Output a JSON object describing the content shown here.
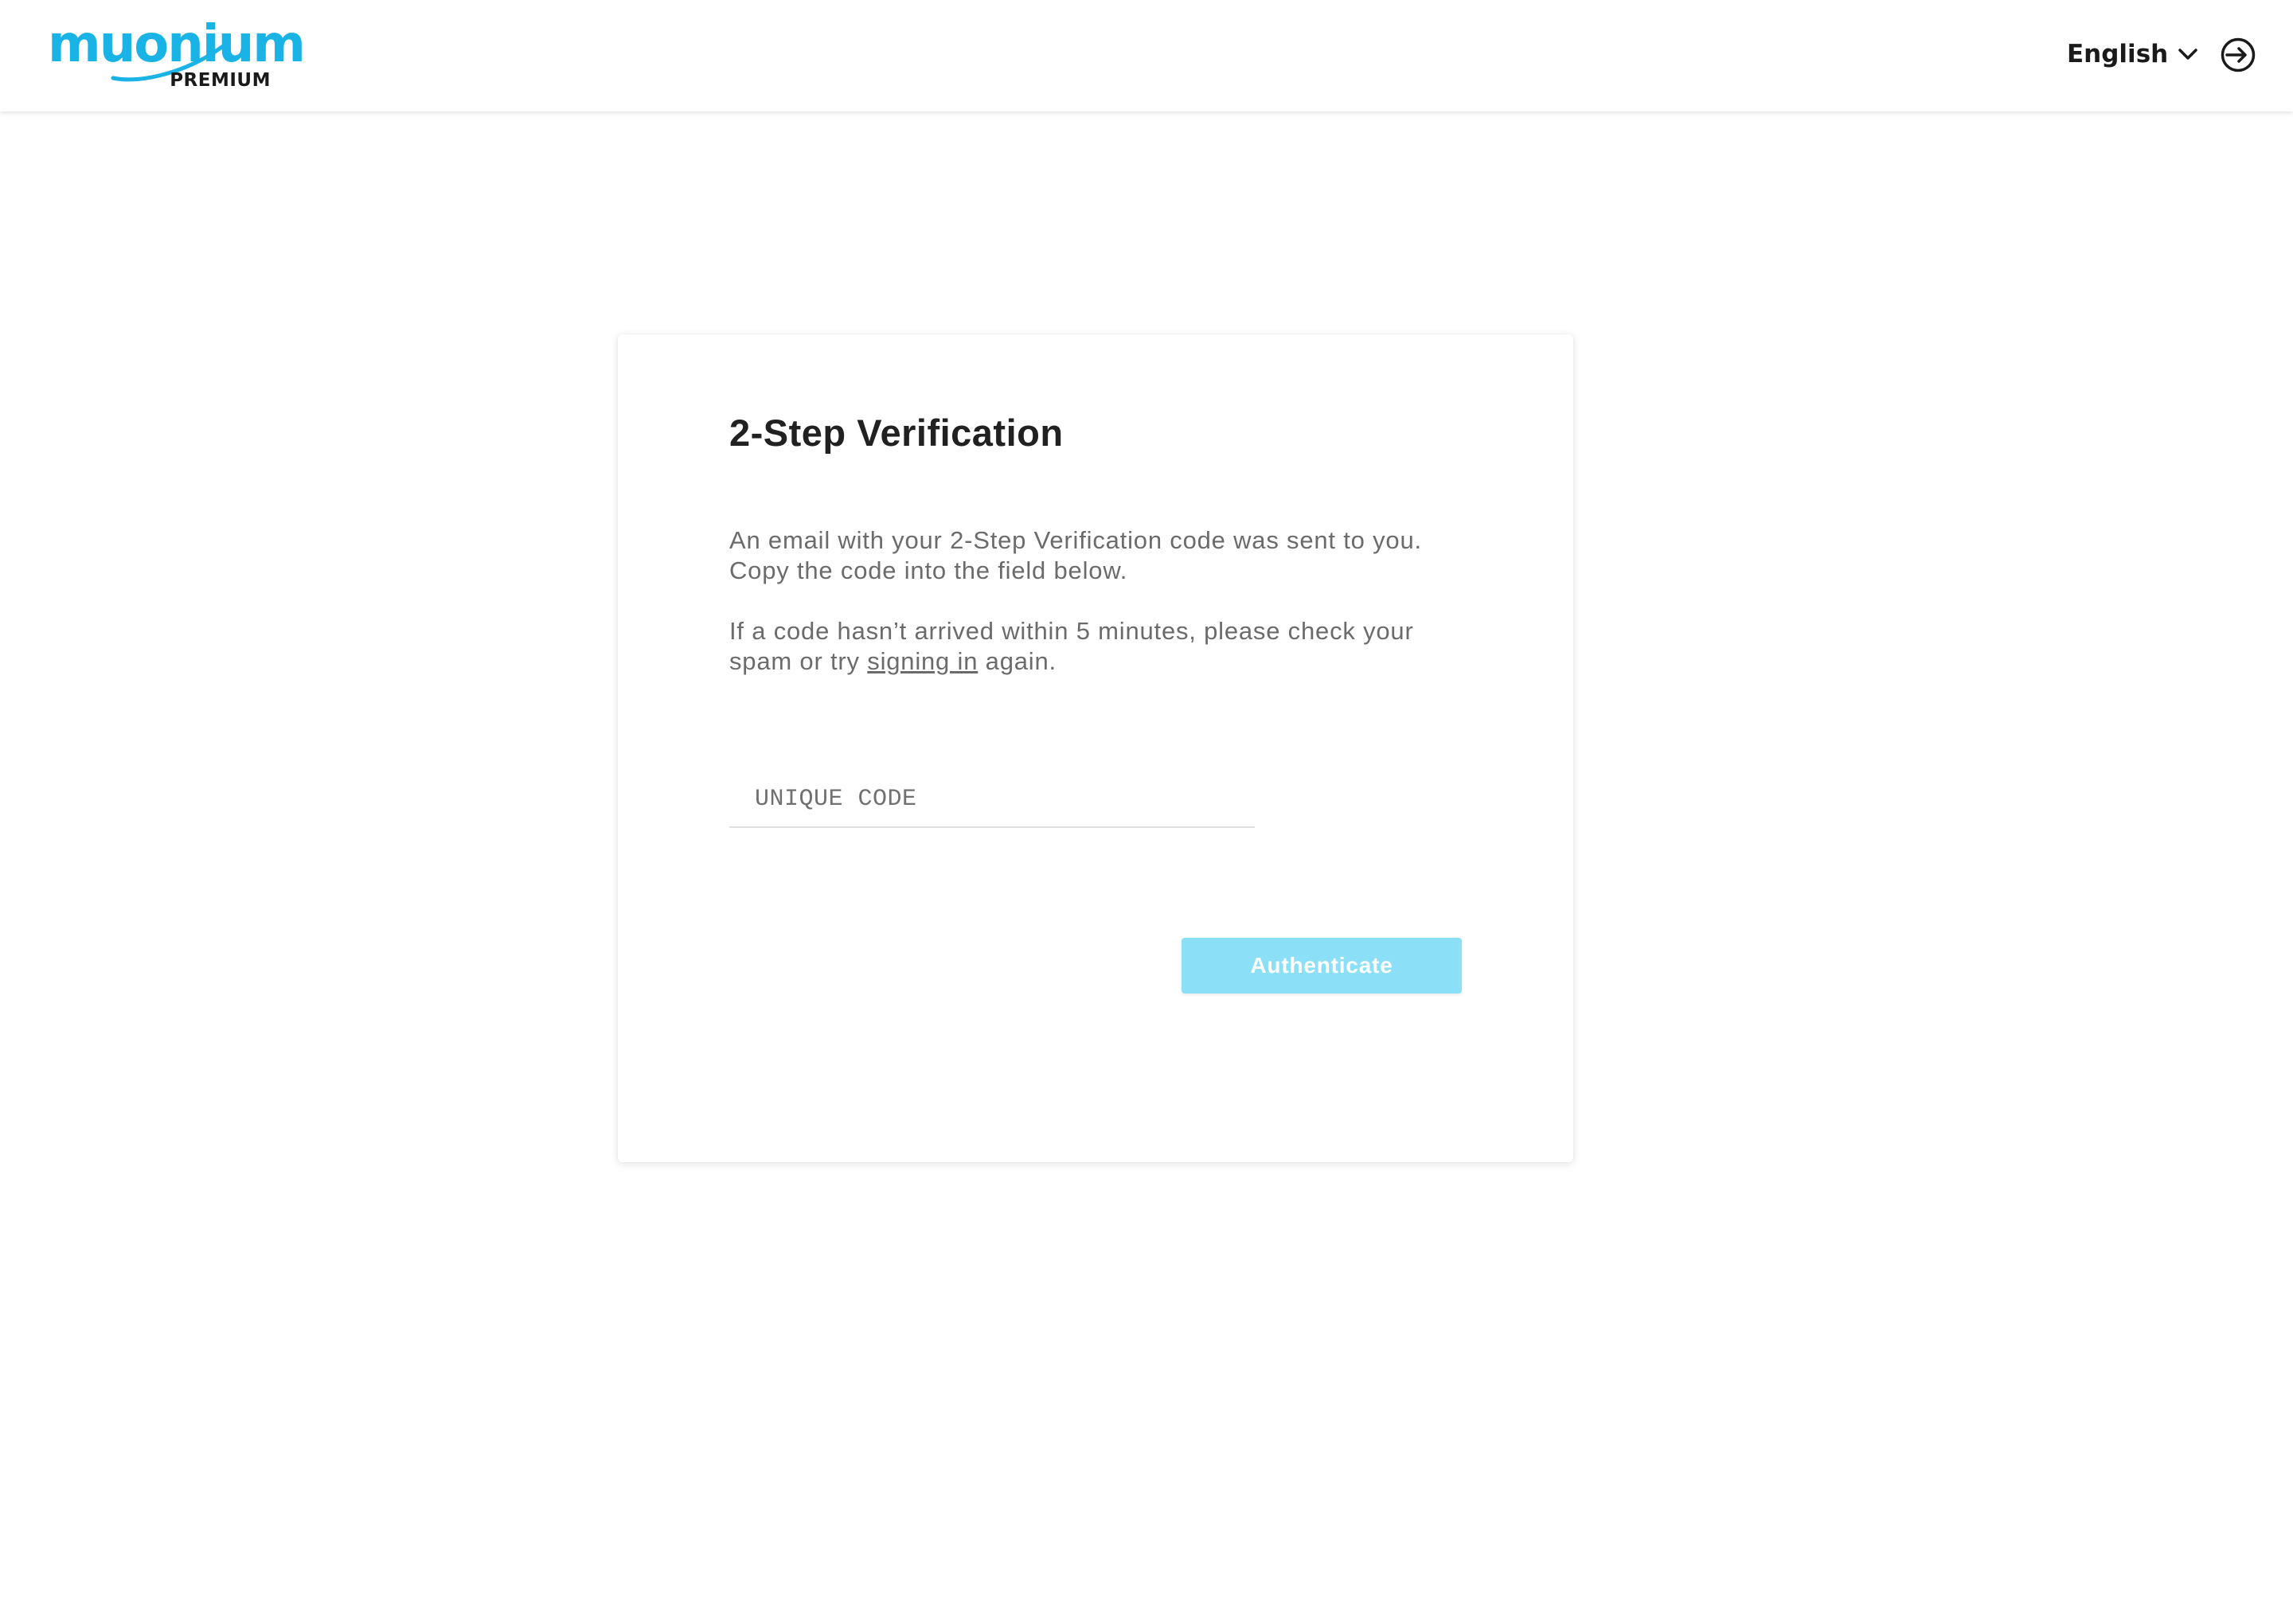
{
  "header": {
    "logo": {
      "wordmark": "muonium",
      "subtitle": "PREMIUM",
      "brand_color": "#1ab3e6"
    },
    "language": {
      "selected": "English",
      "icon": "chevron-down-icon"
    },
    "signin_icon": "sign-in-icon"
  },
  "verification": {
    "title": "2-Step Verification",
    "paragraph1": "An email with your 2-Step Verification code was sent to you. Copy the code into the field below.",
    "paragraph2_before": "If a code hasn’t arrived within 5 minutes, please check your spam or try",
    "paragraph2_link": "signing in",
    "paragraph2_after": "again.",
    "code_placeholder": "UNIQUE CODE",
    "code_value": "",
    "button_label": "Authenticate",
    "button_color": "#8be0f7"
  }
}
